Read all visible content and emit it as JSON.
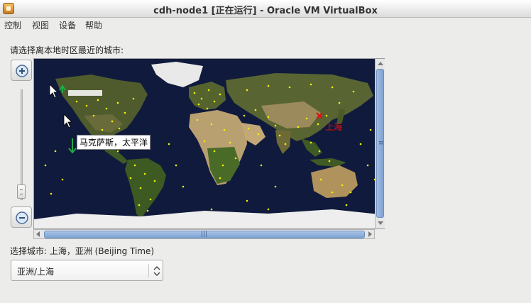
{
  "window": {
    "title": "cdh-node1 [正在运行] - Oracle VM VirtualBox"
  },
  "menubar": {
    "items": [
      "控制",
      "视图",
      "设备",
      "帮助"
    ]
  },
  "timezone": {
    "prompt": "请选择离本地时区最近的城市:",
    "hover_city": "马克萨斯，太平洋",
    "marker_city": "上海",
    "selected_city_text": "选择城市: 上海，亚洲 (Beijing Time)",
    "combo_value": "亚洲/上海"
  },
  "colors": {
    "ocean": "#101a3c",
    "land": "#4f5b2c",
    "desert": "#b9a071",
    "ice": "#eeeeee",
    "city_dot": "#f5f20a",
    "marker": "#e11111",
    "scroll_blue": "#7ea2d2"
  },
  "icons": [
    "app-icon",
    "zoom-in-icon",
    "zoom-out-icon",
    "map-marker-icon",
    "chevron-updown-icon"
  ]
}
